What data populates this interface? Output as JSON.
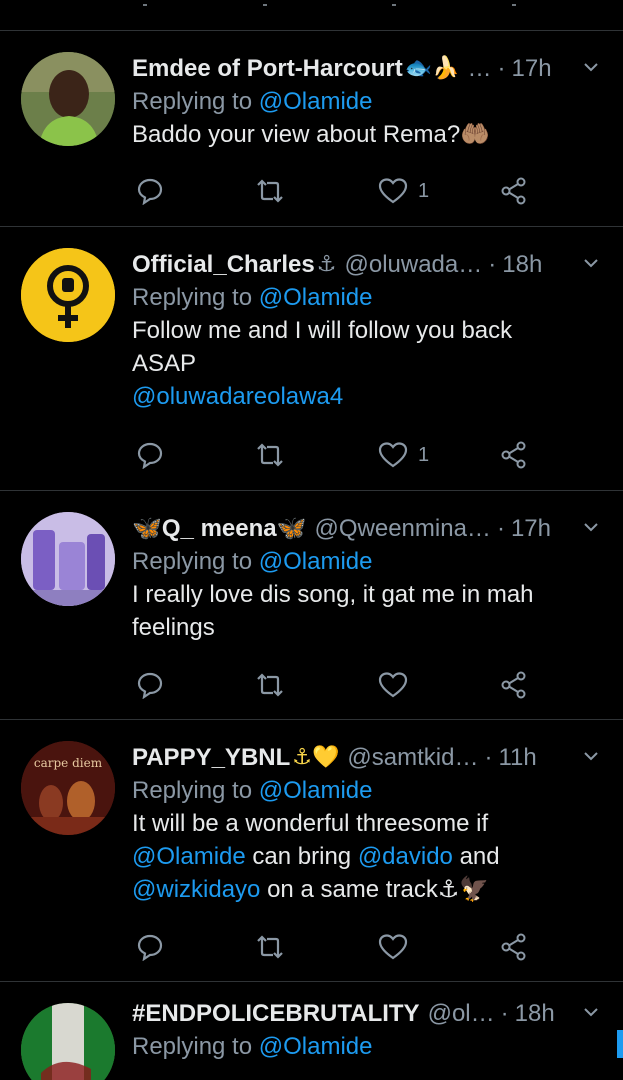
{
  "colors": {
    "background": "#000000",
    "accent": "#1d9bf0",
    "muted": "#8b98a5",
    "divider": "#2f3336"
  },
  "tweets": [
    {
      "name": "Emdee of Port-Harcourt",
      "emojis": "🐟🍌",
      "handle": "…",
      "sep": "·",
      "time": "17h",
      "reply_prefix": "Replying to",
      "reply_to": "@Olamide",
      "text": [
        "Baddo your view about Rema?🤲🏽"
      ],
      "likes": "1",
      "avatar": "boy-photo"
    },
    {
      "name": "Official_Charles",
      "emojis": "⚓",
      "handle": "@oluwada…",
      "sep": "·",
      "time": "18h",
      "reply_prefix": "Replying to",
      "reply_to": "@Olamide",
      "text": [
        "Follow me and I will follow you back",
        "ASAP"
      ],
      "mention_line": "@oluwadareolawa4",
      "likes": "1",
      "avatar": "female-fist-symbol"
    },
    {
      "name": "🦋Q_ meena🦋",
      "emojis": "",
      "handle": "@Qweenmina…",
      "sep": "·",
      "time": "17h",
      "reply_prefix": "Replying to",
      "reply_to": "@Olamide",
      "text": [
        "I really love dis song, it gat me in mah",
        "feelings"
      ],
      "likes": "",
      "avatar": "purple-products"
    },
    {
      "name": "PAPPY_YBNL",
      "emojis": "⚓💛",
      "handle": "@samtkid…",
      "sep": "·",
      "time": "11h",
      "reply_prefix": "Replying to",
      "reply_to": "@Olamide",
      "line1": "It will be a wonderful threesome if",
      "line2_mention1": "@Olamide",
      "line2_mid": " can bring ",
      "line2_mention2": "@davido",
      "line2_end": " and",
      "line3_mention": "@wizkidayo",
      "line3_end": " on a same track⚓🦅",
      "likes": "",
      "avatar": "carpe-diem-art",
      "avatar_text": "carpe diem"
    },
    {
      "name": "#ENDPOLICEBRUTALITY",
      "emojis": "",
      "handle": "@ol…",
      "sep": "·",
      "time": "18h",
      "reply_prefix": "Replying to",
      "reply_to": "@Olamide",
      "avatar": "nigeria-flag-art"
    }
  ]
}
